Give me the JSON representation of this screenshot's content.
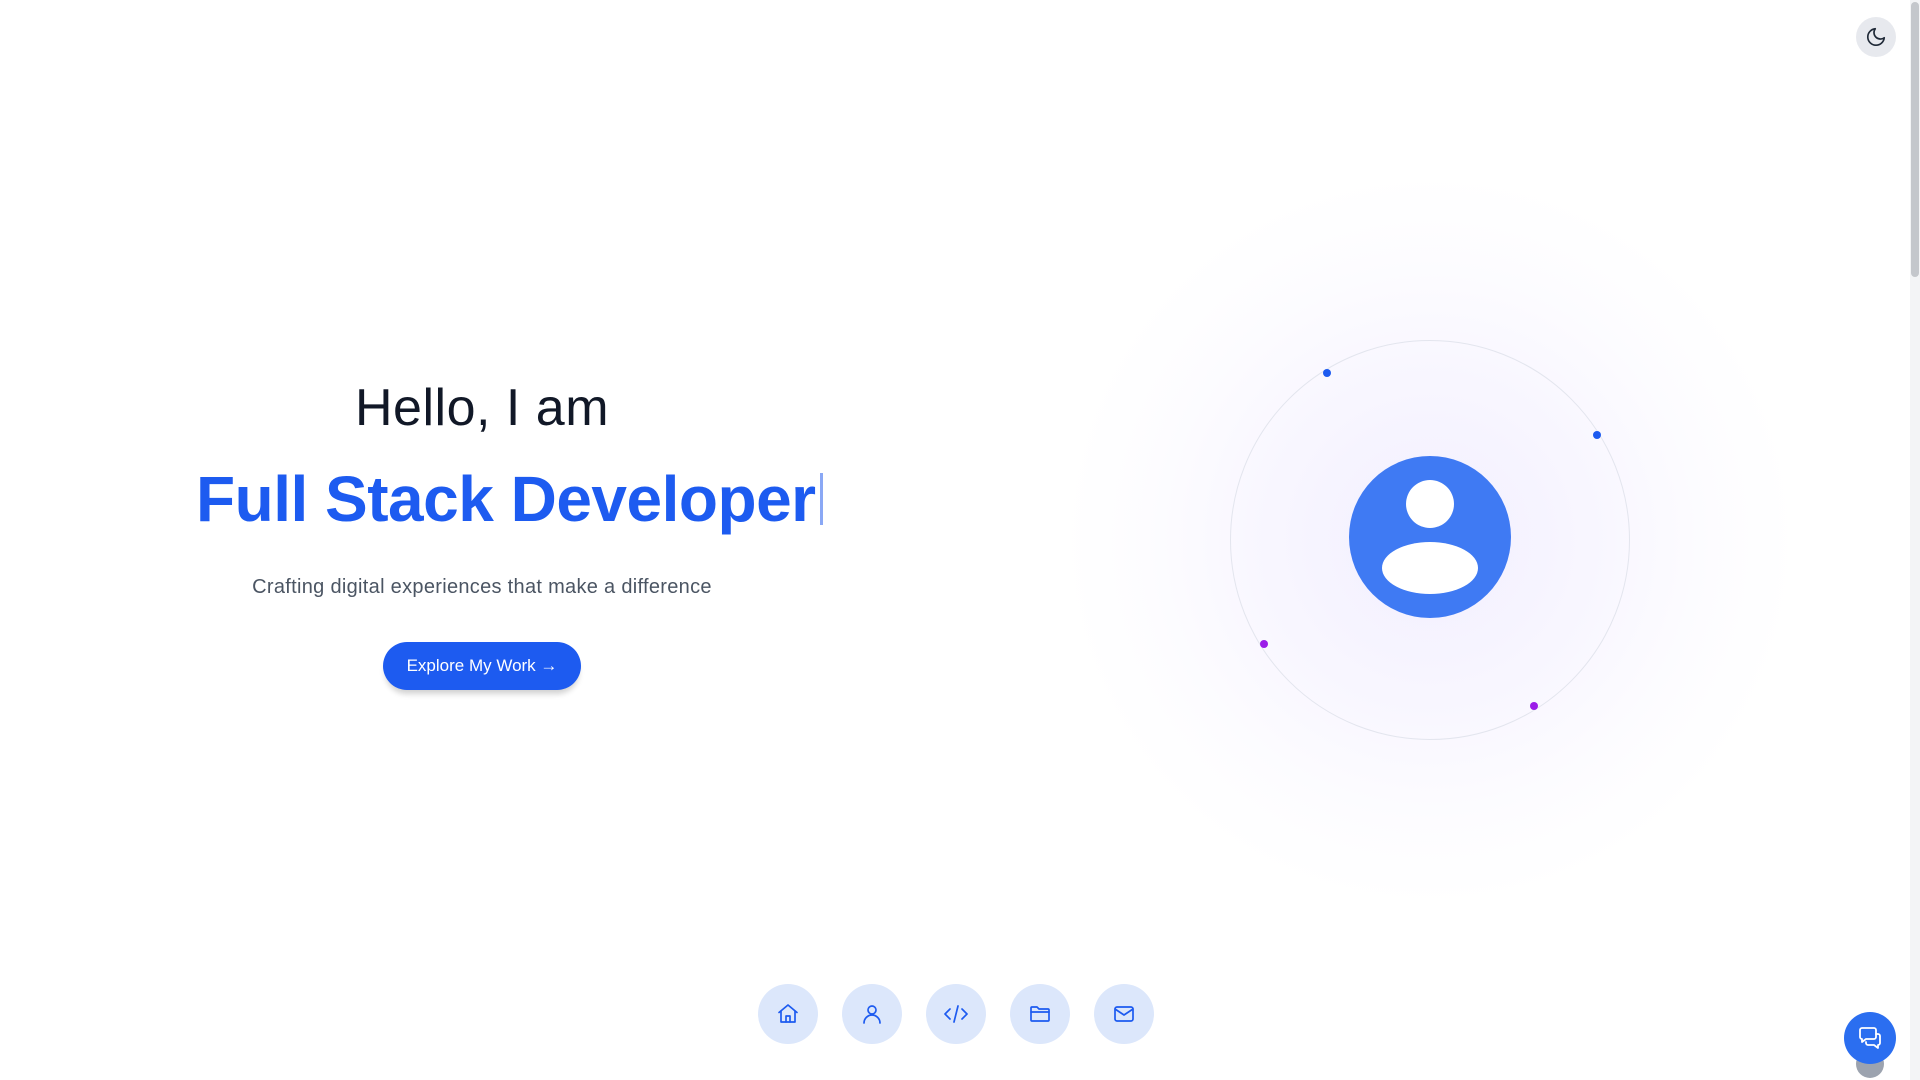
{
  "hero": {
    "greeting": "Hello, I am",
    "role": "Full Stack Developer",
    "tagline": "Crafting digital experiences that make a difference",
    "cta_label": "Explore My Work →"
  },
  "icons": {
    "theme_toggle": "moon-icon",
    "avatar": "user-avatar-icon",
    "chat": "chat-icon",
    "nav": [
      "home-icon",
      "user-icon",
      "code-icon",
      "folder-icon",
      "mail-icon"
    ]
  },
  "colors": {
    "accent": "#1d5bf0",
    "avatar_bg": "#3f7af3",
    "nav_bg": "#dce7fb",
    "dot_blue": "#1d5bf0",
    "dot_purple": "#9b1de8"
  }
}
